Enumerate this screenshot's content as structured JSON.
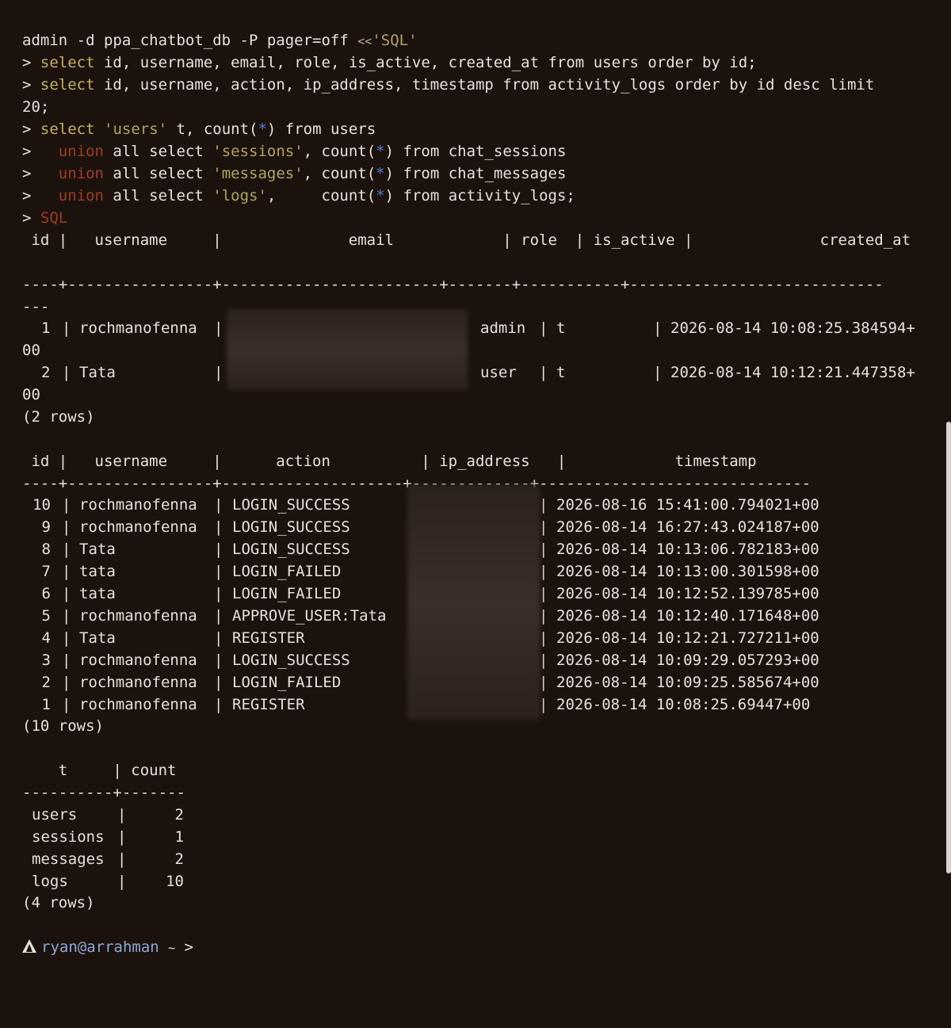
{
  "command": {
    "lead": "admin -d ppa_chatbot_db -P pager=off ",
    "heredoc_op": "<<",
    "heredoc_tag": "'SQL'",
    "cont_prompt": ">",
    "q1_select": "select",
    "q1_rest": " id, username, email, role, is_active, created_at from users order by id;",
    "q2_select": "select",
    "q2_rest": " id, username, action, ip_address, timestamp from activity_logs order by id desc limit",
    "q2_wrap": "20;",
    "q3_select": "select",
    "q3_str": "'users'",
    "q3_rest_a": " t, count(",
    "star": "*",
    "q3_rest_b": ") from users",
    "union_word": "union",
    "u1_mid": " all select ",
    "u1_str": "'sessions'",
    "u1_a": ", count(",
    "u1_b": ") from chat_sessions",
    "u2_str": "'messages'",
    "u2_b": ") from chat_messages",
    "u3_str": "'logs'",
    "u3_a": ",     count(",
    "u3_b": ") from activity_logs;",
    "end_tag": "SQL"
  },
  "users_table": {
    "header": " id |   username     |              email            | role  | is_active |              created_at",
    "separator1": "----+----------------+------------------------+-------+-----------+----------------------------",
    "separator2": "---",
    "rows": [
      {
        "id": "1",
        "username": "rochmanofenna",
        "email": "",
        "role": "admin",
        "is_active": "t",
        "created_at": "2026-08-14 10:08:25.384594+",
        "wrap": "00"
      },
      {
        "id": "2",
        "username": "Tata",
        "email": "",
        "role": "user",
        "is_active": "t",
        "created_at": "2026-08-14 10:12:21.447358+",
        "wrap": "00"
      }
    ],
    "footer": "(2 rows)"
  },
  "logs_table": {
    "header": " id |   username     |      action          | ip_address   |            timestamp",
    "separator": "----+----------------+--------------------+-------------+------------------------------",
    "rows": [
      {
        "id": "10",
        "username": "rochmanofenna",
        "action": "LOGIN_SUCCESS",
        "ip": "",
        "timestamp": "2026-08-16 15:41:00.794021+00"
      },
      {
        "id": "9",
        "username": "rochmanofenna",
        "action": "LOGIN_SUCCESS",
        "ip": "",
        "timestamp": "2026-08-14 16:27:43.024187+00"
      },
      {
        "id": "8",
        "username": "Tata",
        "action": "LOGIN_SUCCESS",
        "ip": "",
        "timestamp": "2026-08-14 10:13:06.782183+00"
      },
      {
        "id": "7",
        "username": "tata",
        "action": "LOGIN_FAILED",
        "ip": "",
        "timestamp": "2026-08-14 10:13:00.301598+00"
      },
      {
        "id": "6",
        "username": "tata",
        "action": "LOGIN_FAILED",
        "ip": "",
        "timestamp": "2026-08-14 10:12:52.139785+00"
      },
      {
        "id": "5",
        "username": "rochmanofenna",
        "action": "APPROVE_USER:Tata",
        "ip": "",
        "timestamp": "2026-08-14 10:12:40.171648+00"
      },
      {
        "id": "4",
        "username": "Tata",
        "action": "REGISTER",
        "ip": "",
        "timestamp": "2026-08-14 10:12:21.727211+00"
      },
      {
        "id": "3",
        "username": "rochmanofenna",
        "action": "LOGIN_SUCCESS",
        "ip": "",
        "timestamp": "2026-08-14 10:09:29.057293+00"
      },
      {
        "id": "2",
        "username": "rochmanofenna",
        "action": "LOGIN_FAILED",
        "ip": "",
        "timestamp": "2026-08-14 10:09:25.585674+00"
      },
      {
        "id": "1",
        "username": "rochmanofenna",
        "action": "REGISTER",
        "ip": "",
        "timestamp": "2026-08-14 10:08:25.69447+00"
      }
    ],
    "footer": "(10 rows)"
  },
  "count_table": {
    "header": "    t     | count",
    "separator": "----------+-------",
    "rows": [
      {
        "t": "users",
        "count": "2"
      },
      {
        "t": "sessions",
        "count": "1"
      },
      {
        "t": "messages",
        "count": "2"
      },
      {
        "t": "logs",
        "count": "10"
      }
    ],
    "footer": "(4 rows)"
  },
  "shell_prompt": {
    "icon": "arch-logo-icon",
    "user_host": "ryan@arrahman",
    "path": "~",
    "symbol": ">"
  },
  "colors": {
    "background": "#1b120d",
    "foreground": "#e8e1d9",
    "keyword": "#c5b25c",
    "union": "#a23c22",
    "star": "#4e7ed1",
    "user_host": "#8fa7d9"
  }
}
